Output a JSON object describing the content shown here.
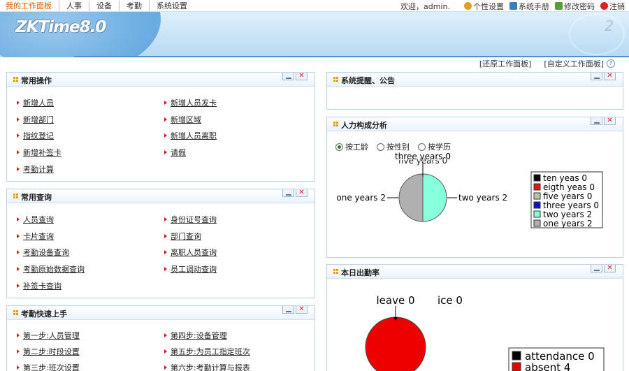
{
  "nav": {
    "items": [
      "我的工作面板",
      "人事",
      "设备",
      "考勤",
      "系统设置"
    ],
    "welcome": "欢迎，admin.",
    "right_links": [
      {
        "label": "个性设置",
        "icon": "settings-icon",
        "color": "#e0a020"
      },
      {
        "label": "系统手册",
        "icon": "manual-icon",
        "color": "#3a7bc8"
      },
      {
        "label": "修改密码",
        "icon": "password-icon",
        "color": "#5a9a3a"
      },
      {
        "label": "注销",
        "icon": "logout-icon",
        "color": "#d22"
      }
    ]
  },
  "banner": {
    "logo": "ZKTime8.0",
    "deco_number": "2"
  },
  "panel_links": {
    "restore": "[还原工作面板]",
    "customize": "[自定义工作面板]"
  },
  "panels": {
    "common_ops": {
      "title": "常用操作",
      "links": [
        "新增人员",
        "新增人员发卡",
        "新增部门",
        "新增区域",
        "指纹登记",
        "新增人员离职",
        "新增补签卡",
        "请假",
        "考勤计算"
      ]
    },
    "common_query": {
      "title": "常用查询",
      "links": [
        "人员查询",
        "身份证号查询",
        "卡片查询",
        "部门查询",
        "考勤设备查询",
        "离职人员查询",
        "考勤原始数据查询",
        "员工调动查询",
        "补签卡查询"
      ]
    },
    "quick_start": {
      "title": "考勤快速上手",
      "links": [
        "第一步:人员管理",
        "第四步:设备管理",
        "第二步:时段设置",
        "第五步:为员工指定班次",
        "第三步:班次设置",
        "第六步:考勤计算与报表"
      ]
    },
    "notice": {
      "title": "系统提醒、公告"
    },
    "hr_analysis": {
      "title": "人力构成分析",
      "radios": [
        "按工龄",
        "按性别",
        "按学历"
      ],
      "selected_radio": 0
    },
    "attendance_rate": {
      "title": "本日出勤率"
    }
  },
  "chart_data": [
    {
      "type": "pie",
      "labels": [
        "ten yeas",
        "eigth yeas",
        "five years",
        "three years",
        "two years",
        "one years"
      ],
      "values": [
        0,
        0,
        0,
        0,
        2,
        2
      ],
      "legend": [
        "ten yeas 0",
        "eigth yeas 0",
        "five years 0",
        "three years 0",
        "two years 2",
        "one years 2"
      ],
      "colors": [
        "#000000",
        "#ee1111",
        "#b8c8b0",
        "#1111cc",
        "#88ffdd",
        "#b0b0b0"
      ],
      "slice_labels": [
        "three years 0",
        "five years 0",
        "one years 2",
        "two years 2"
      ],
      "legend_position": "right"
    },
    {
      "type": "pie",
      "labels": [
        "attendance",
        "absent"
      ],
      "values": [
        0,
        4
      ],
      "legend": [
        "attendance 0",
        "absent 4"
      ],
      "colors": [
        "#000000",
        "#ee0000"
      ],
      "slice_labels": [
        "leave 0",
        "ice 0"
      ],
      "legend_position": "right"
    }
  ]
}
